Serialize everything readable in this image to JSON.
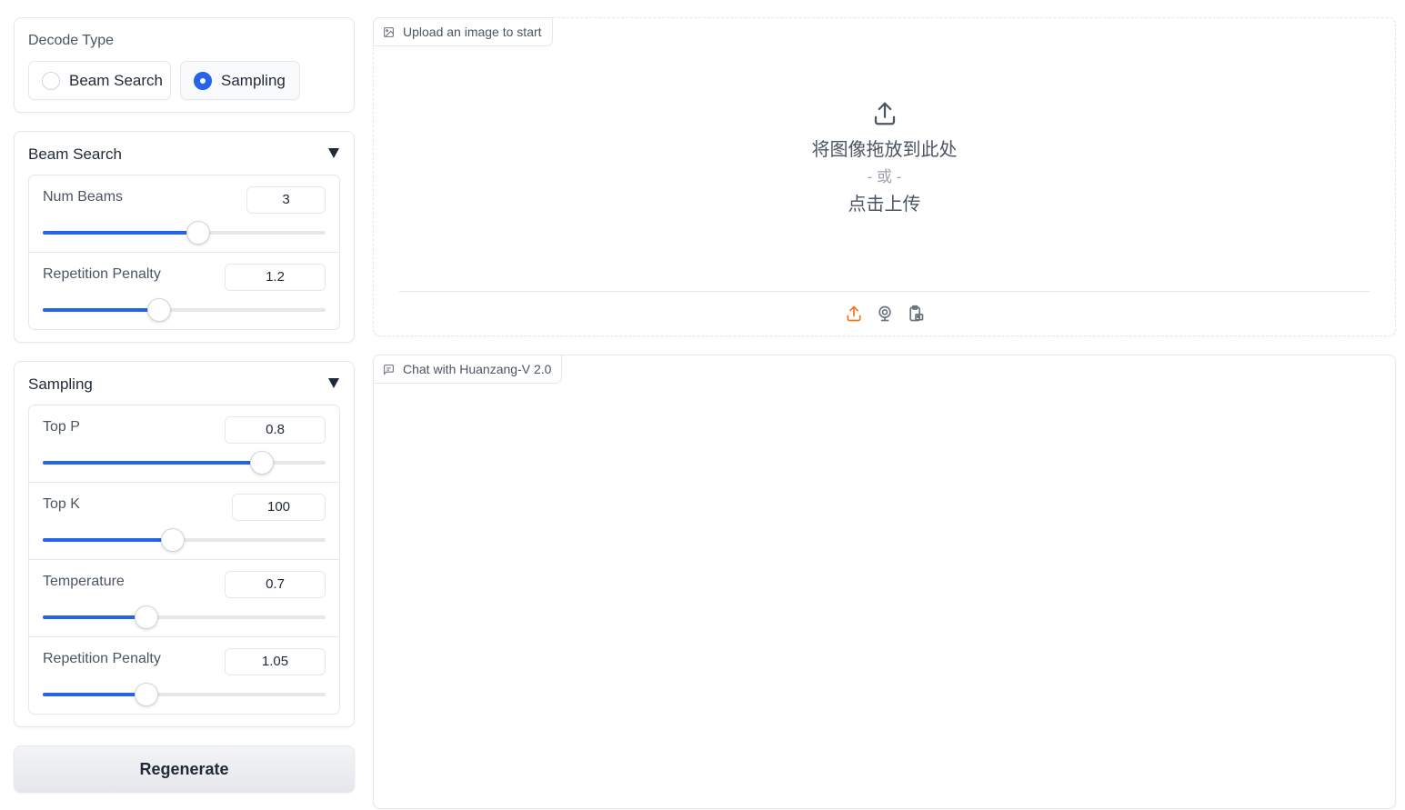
{
  "decode": {
    "label": "Decode Type",
    "options": [
      {
        "label": "Beam Search",
        "selected": false
      },
      {
        "label": "Sampling",
        "selected": true
      }
    ]
  },
  "beam_search": {
    "title": "Beam Search",
    "sliders": [
      {
        "label": "Num Beams",
        "value": "3",
        "fraction": 0.55
      },
      {
        "label": "Repetition Penalty",
        "value": "1.2",
        "fraction": 0.41
      }
    ]
  },
  "sampling": {
    "title": "Sampling",
    "sliders": [
      {
        "label": "Top P",
        "value": "0.8",
        "fraction": 0.775
      },
      {
        "label": "Top K",
        "value": "100",
        "fraction": 0.46
      },
      {
        "label": "Temperature",
        "value": "0.7",
        "fraction": 0.365
      },
      {
        "label": "Repetition Penalty",
        "value": "1.05",
        "fraction": 0.365
      }
    ]
  },
  "regenerate_label": "Regenerate",
  "upload": {
    "label": "Upload an image to start",
    "drop_text": "将图像拖放到此处",
    "or_text": "- 或 -",
    "click_text": "点击上传",
    "accent_color": "#f97316"
  },
  "chat": {
    "label": "Chat with Huanzang-V 2.0"
  },
  "accent_color": "#2563eb"
}
